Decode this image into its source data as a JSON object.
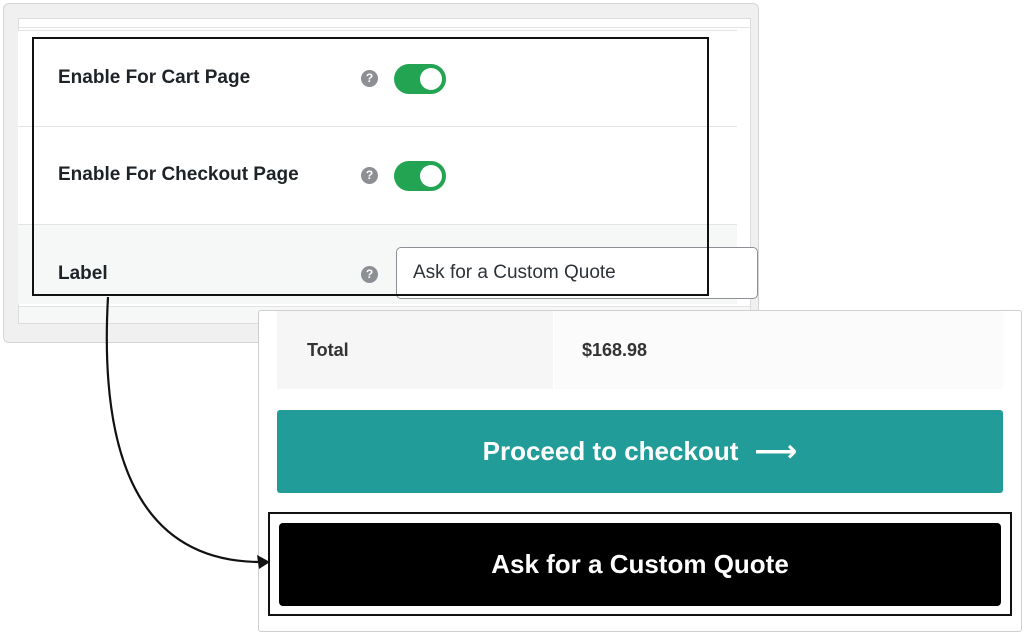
{
  "settings": {
    "rows": [
      {
        "label": "Enable For Cart Page",
        "enabled": true,
        "help_icon": "question-circle-icon"
      },
      {
        "label": "Enable For Checkout Page",
        "enabled": true,
        "help_icon": "question-circle-icon"
      },
      {
        "label": "Label",
        "help_icon": "question-circle-icon",
        "input_value": "Ask for a Custom Quote"
      }
    ],
    "help_glyph": "?",
    "toggle_on_color": "#22a452"
  },
  "cart": {
    "total_label": "Total",
    "total_value": "$168.98",
    "checkout_label": "Proceed to checkout",
    "checkout_icon": "arrow-right-icon",
    "checkout_color": "#219c98",
    "quote_label": "Ask for a Custom Quote",
    "quote_color": "#000000"
  },
  "connector_icon": "curved-arrow-icon"
}
